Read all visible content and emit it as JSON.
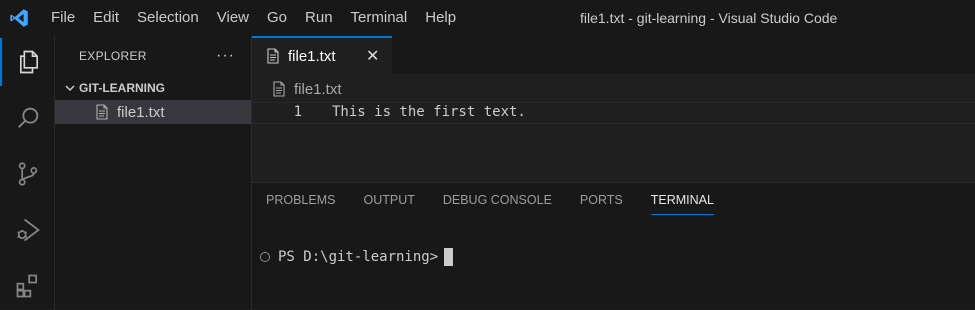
{
  "menu": {
    "items": [
      "File",
      "Edit",
      "Selection",
      "View",
      "Go",
      "Run",
      "Terminal",
      "Help"
    ]
  },
  "window_title": "file1.txt - git-learning - Visual Studio Code",
  "activity_bar": {
    "items": [
      "explorer-icon",
      "search-icon",
      "source-control-icon",
      "run-debug-icon",
      "extensions-icon"
    ]
  },
  "sidebar": {
    "title": "EXPLORER",
    "more": "···",
    "folder": "GIT-LEARNING",
    "files": [
      {
        "name": "file1.txt"
      }
    ]
  },
  "editor": {
    "tab": {
      "label": "file1.txt",
      "close": "✕"
    },
    "breadcrumb": "file1.txt",
    "lines": [
      {
        "number": "1",
        "text": "This is the first text."
      }
    ]
  },
  "panel": {
    "tabs": [
      "PROBLEMS",
      "OUTPUT",
      "DEBUG CONSOLE",
      "PORTS",
      "TERMINAL"
    ],
    "active_tab": "TERMINAL",
    "terminal_prompt": "PS D:\\git-learning>"
  },
  "colors": {
    "accent": "#0078d4",
    "logo": "#3ea7ff",
    "background": "#1f1f1f"
  }
}
